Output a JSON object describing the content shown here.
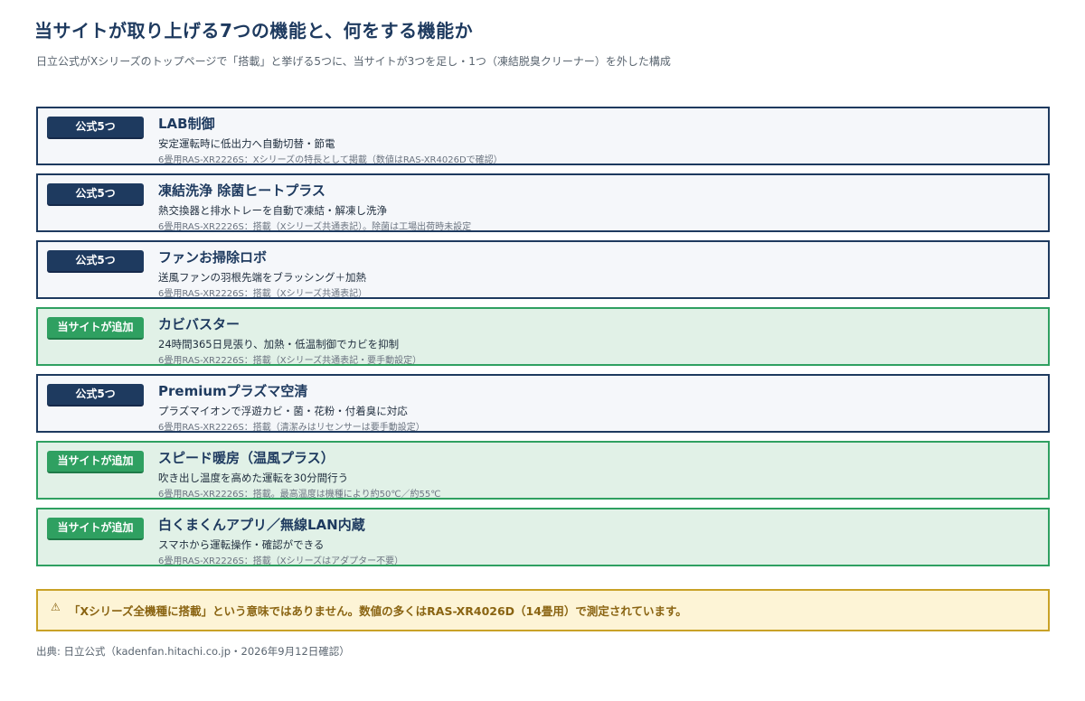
{
  "header": {
    "title": "当サイトが取り上げる7つの機能と、何をする機能か",
    "subtitle": "日立公式がXシリーズのトップページで「搭載」と挙げる5つに、当サイトが3つを足し・1つ（凍結脱臭クリーナー）を外した構成"
  },
  "features": [
    {
      "badge": "公式5つ",
      "type": "official",
      "title": "LAB制御",
      "desc": "安定運転時に低出力へ自動切替・節電",
      "note": "6畳用RAS-XR2226S：Xシリーズの特長として掲載（数値はRAS-XR4026Dで確認）"
    },
    {
      "badge": "公式5つ",
      "type": "official",
      "title": "凍結洗浄 除菌ヒートプラス",
      "desc": "熱交換器と排水トレーを自動で凍結・解凍し洗浄",
      "note": "6畳用RAS-XR2226S：搭載（Xシリーズ共通表記）。除菌は工場出荷時未設定"
    },
    {
      "badge": "公式5つ",
      "type": "official",
      "title": "ファンお掃除ロボ",
      "desc": "送風ファンの羽根先端をブラッシング＋加熱",
      "note": "6畳用RAS-XR2226S：搭載（Xシリーズ共通表記）"
    },
    {
      "badge": "当サイトが追加",
      "type": "added",
      "title": "カビバスター",
      "desc": "24時間365日見張り、加熱・低温制御でカビを抑制",
      "note": "6畳用RAS-XR2226S：搭載（Xシリーズ共通表記・要手動設定）"
    },
    {
      "badge": "公式5つ",
      "type": "official",
      "title": "Premiumプラズマ空清",
      "desc": "プラズマイオンで浮遊カビ・菌・花粉・付着臭に対応",
      "note": "6畳用RAS-XR2226S：搭載（清潔みはリセンサーは要手動設定）"
    },
    {
      "badge": "当サイトが追加",
      "type": "added",
      "title": "スピード暖房（温風プラス）",
      "desc": "吹き出し温度を高めた運転を30分間行う",
      "note": "6畳用RAS-XR2226S：搭載。最高温度は機種により約50℃／約55℃"
    },
    {
      "badge": "当サイトが追加",
      "type": "added",
      "title": "白くまくんアプリ／無線LAN内蔵",
      "desc": "スマホから運転操作・確認ができる",
      "note": "6畳用RAS-XR2226S：搭載（Xシリーズはアダプター不要）"
    }
  ],
  "warning": {
    "icon": "warning-icon",
    "text": "「Xシリーズ全機種に搭載」という意味ではありません。数値の多くはRAS-XR4026D（14畳用）で測定されています。"
  },
  "source": "出典: 日立公式（kadenfan.hitachi.co.jp・2026年9月12日確認）",
  "colors": {
    "navy": "#1e3a5f",
    "green": "#2fa061",
    "green_bg": "#e1f1e7",
    "warning_border": "#c9a227",
    "warning_bg": "#fdf4d6"
  }
}
